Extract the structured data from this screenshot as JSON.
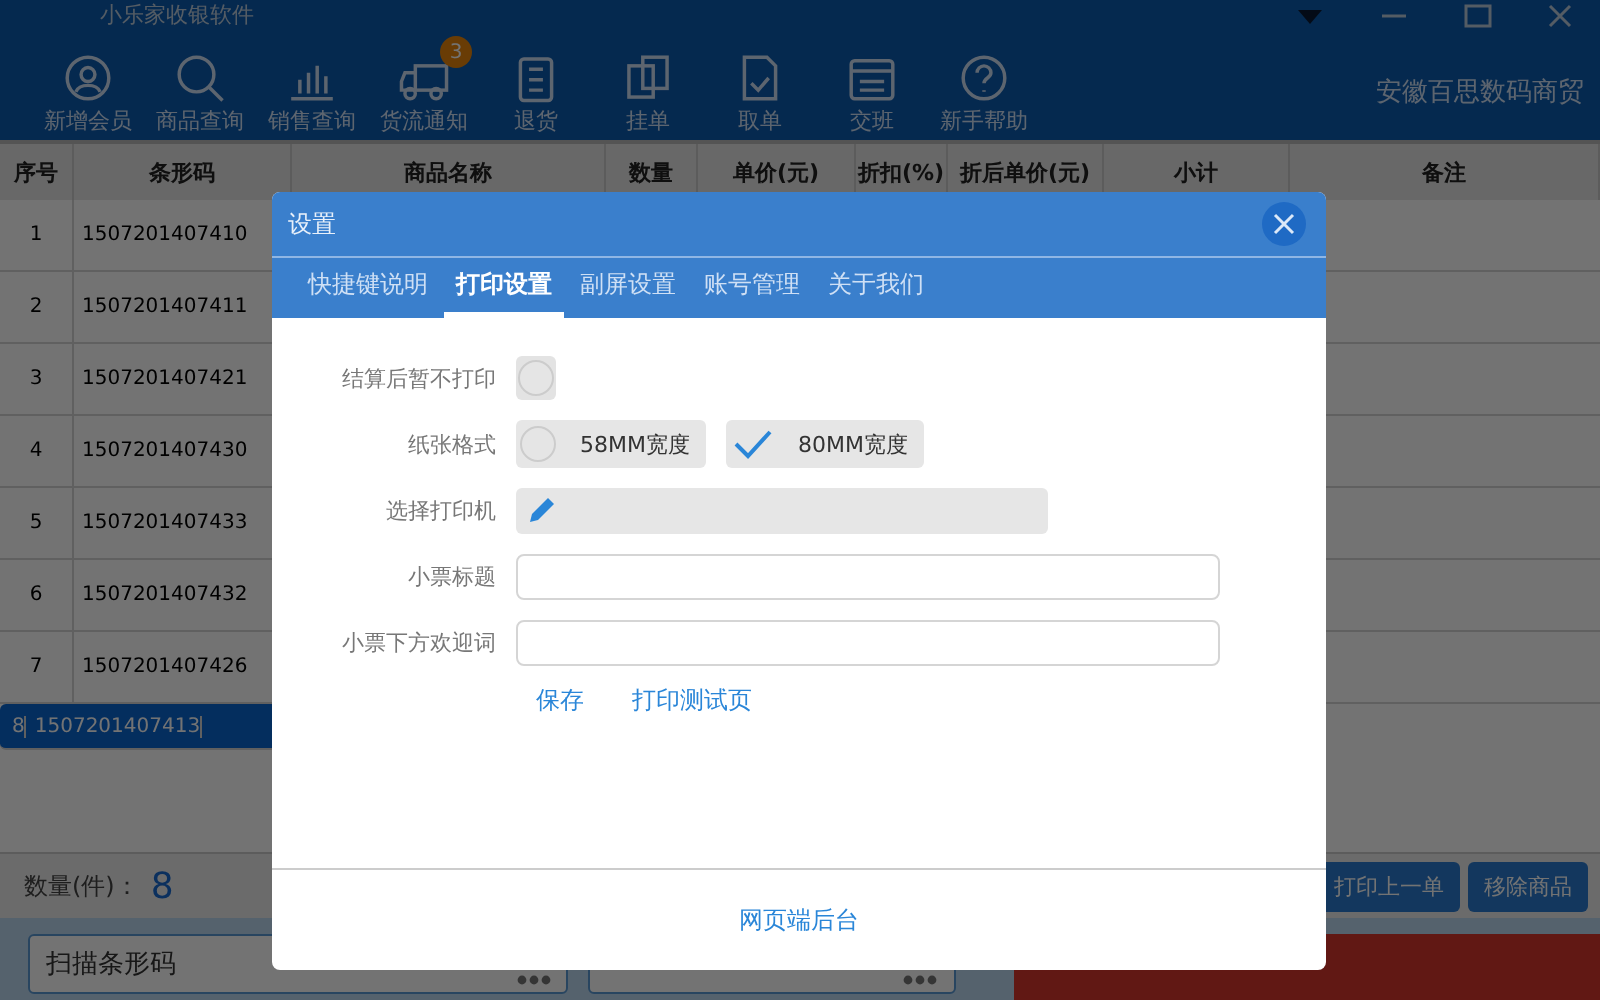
{
  "window": {
    "title": "小乐家收银软件"
  },
  "toolbar": {
    "items": [
      {
        "label": "新增会员"
      },
      {
        "label": "商品查询"
      },
      {
        "label": "销售查询"
      },
      {
        "label": "货流通知",
        "badge": "3"
      },
      {
        "label": "退货"
      },
      {
        "label": "挂单"
      },
      {
        "label": "取单"
      },
      {
        "label": "交班"
      },
      {
        "label": "新手帮助"
      }
    ],
    "company": "安徽百思数码商贸"
  },
  "table": {
    "columns": [
      "序号",
      "条形码",
      "商品名称",
      "数量",
      "单价(元)",
      "折扣(%)",
      "折后单价(元)",
      "小计",
      "备注"
    ],
    "rows": [
      {
        "cells": [
          "1",
          "1507201407410"
        ],
        "selected": false
      },
      {
        "cells": [
          "2",
          "1507201407411"
        ],
        "selected": false
      },
      {
        "cells": [
          "3",
          "1507201407421"
        ],
        "selected": false
      },
      {
        "cells": [
          "4",
          "1507201407430"
        ],
        "selected": false
      },
      {
        "cells": [
          "5",
          "1507201407433"
        ],
        "selected": false
      },
      {
        "cells": [
          "6",
          "1507201407432"
        ],
        "selected": false
      },
      {
        "cells": [
          "7",
          "1507201407426"
        ],
        "selected": false
      },
      {
        "cells": [
          "8",
          "1507201407413"
        ],
        "selected": true
      }
    ]
  },
  "summary": {
    "label": "数量(件)：",
    "value": "8"
  },
  "actions": [
    "打印上一单",
    "移除商品"
  ],
  "scan_field": {
    "placeholder": "扫描条形码"
  },
  "dialog": {
    "title": "设置",
    "tabs": [
      {
        "label": "快捷键说明",
        "selected": false
      },
      {
        "label": "打印设置",
        "selected": true
      },
      {
        "label": "副屏设置",
        "selected": false
      },
      {
        "label": "账号管理",
        "selected": false
      },
      {
        "label": "关于我们",
        "selected": false
      }
    ],
    "fields": [
      {
        "kind": "checkbox",
        "label": "结算后暂不打印",
        "checked": false
      },
      {
        "kind": "radio",
        "label": "纸张格式",
        "options": [
          {
            "label": "58MM宽度",
            "selected": false
          },
          {
            "label": "80MM宽度",
            "selected": true
          }
        ]
      },
      {
        "kind": "select",
        "label": "选择打印机"
      },
      {
        "kind": "text",
        "label": "小票标题"
      },
      {
        "kind": "text",
        "label": "小票下方欢迎词"
      }
    ],
    "links": [
      "保存",
      "打印测试页"
    ],
    "footer_link": "网页端后台"
  }
}
